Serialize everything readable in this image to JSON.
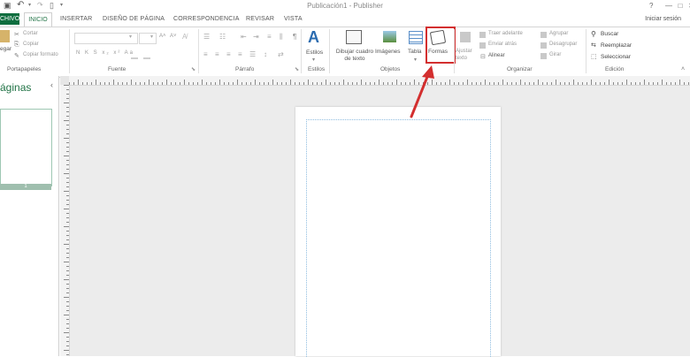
{
  "title_bar": {
    "title": "Publicación1 - Publisher",
    "help": "?",
    "window_controls": "—   □   ✕"
  },
  "tabs": [
    "CHIVO",
    "INICIO",
    "INSERTAR",
    "DISEÑO DE PÁGINA",
    "CORRESPONDENCIA",
    "REVISAR",
    "VISTA"
  ],
  "sign_in": "Iniciar sesión",
  "ribbon": {
    "clipboard": {
      "paste": "egar",
      "cut": "Cortar",
      "copy": "Copiar",
      "format_painter": "Copiar formato",
      "label": "Portapapeles"
    },
    "font": {
      "label": "Fuente",
      "styles": "N  K  S  x₂  x²  Aa",
      "size_up": "A˄",
      "size_down": "A˅"
    },
    "paragraph": {
      "label": "Párrafo",
      "pilcrow": "¶"
    },
    "styles": {
      "label": "Estilos"
    },
    "objects": {
      "label": "Objetos",
      "draw_textbox": "Dibujar cuadro de texto",
      "images": "Imágenes",
      "table": "Tabla",
      "shapes": "Formas"
    },
    "arrange": {
      "label": "Organizar",
      "wrap_text": "Ajustar texto",
      "bring_forward": "Traer adelante",
      "send_backward": "Enviar atrás",
      "align": "Alinear",
      "group": "Agrupar",
      "ungroup": "Desagrupar",
      "rotate": "Girar"
    },
    "editing": {
      "label": "Edición",
      "find": "Buscar",
      "replace": "Reemplazar",
      "select": "Seleccionar"
    }
  },
  "pages_pane": {
    "title": "áginas",
    "collapse": "‹",
    "page_number": "1"
  },
  "accent": "#217346",
  "highlight_color": "#d32f2f"
}
